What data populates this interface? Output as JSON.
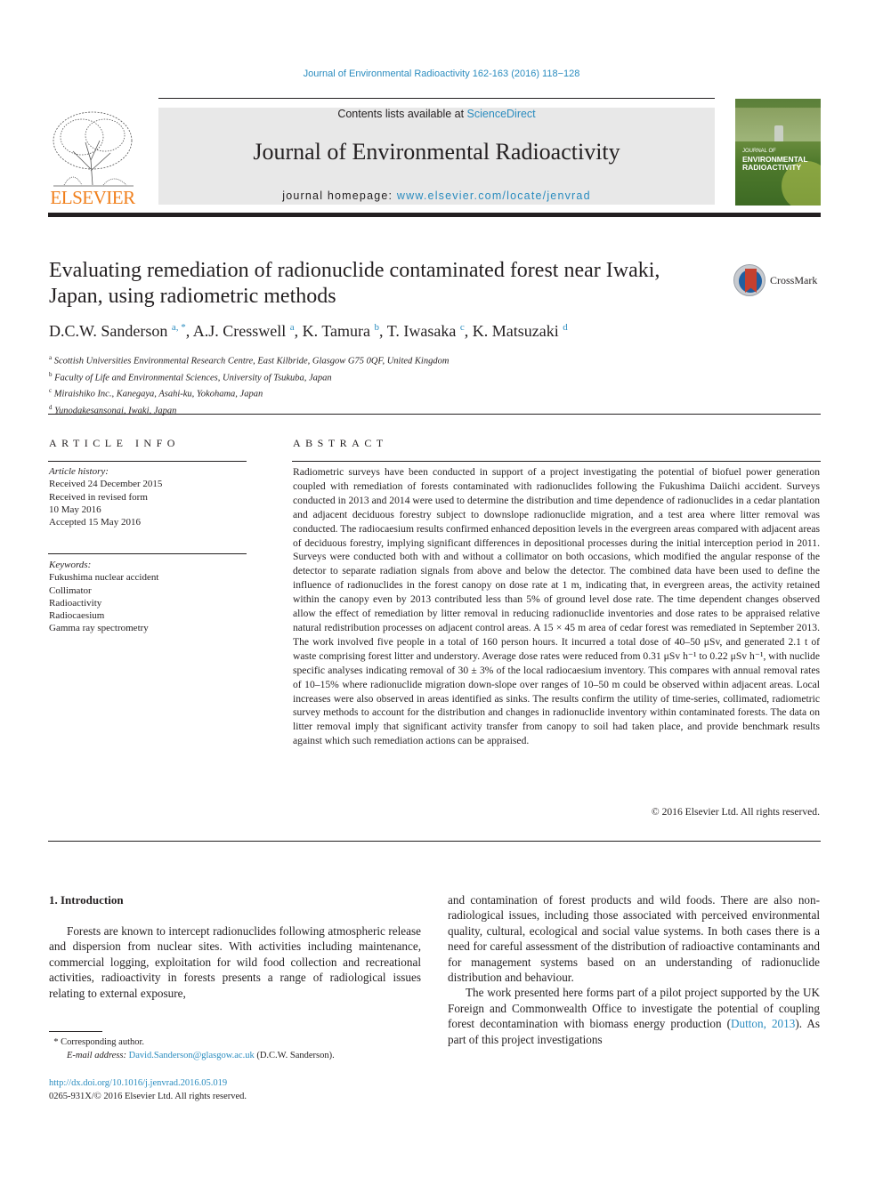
{
  "running_head": "Journal of Environmental Radioactivity 162-163 (2016) 118−128",
  "masthead": {
    "publisher_wordmark": "ELSEVIER",
    "contents_prefix": "Contents lists available at ",
    "contents_link": "ScienceDirect",
    "journal_name": "Journal of Environmental Radioactivity",
    "homepage_prefix": "journal homepage: ",
    "homepage_link": "www.elsevier.com/locate/jenvrad",
    "cover_title_small": "JOURNAL OF",
    "cover_title_line1": "ENVIRONMENTAL",
    "cover_title_line2": "RADIOACTIVITY"
  },
  "crossmark_label": "CrossMark",
  "title": "Evaluating remediation of radionuclide contaminated forest near Iwaki, Japan, using radiometric methods",
  "authors": [
    {
      "name": "D.C.W. Sanderson",
      "sup": "a, *"
    },
    {
      "name": "A.J. Cresswell",
      "sup": "a"
    },
    {
      "name": "K. Tamura",
      "sup": "b"
    },
    {
      "name": "T. Iwasaka",
      "sup": "c"
    },
    {
      "name": "K. Matsuzaki",
      "sup": "d"
    }
  ],
  "affiliations": [
    {
      "sup": "a",
      "text": "Scottish Universities Environmental Research Centre, East Kilbride, Glasgow G75 0QF, United Kingdom"
    },
    {
      "sup": "b",
      "text": "Faculty of Life and Environmental Sciences, University of Tsukuba, Japan"
    },
    {
      "sup": "c",
      "text": "Miraishiko Inc., Kanegaya, Asahi-ku, Yokohama, Japan"
    },
    {
      "sup": "d",
      "text": "Yunodakesansonai, Iwaki, Japan"
    }
  ],
  "article_info": {
    "heading": "ARTICLE INFO",
    "history_label": "Article history:",
    "history": [
      "Received 24 December 2015",
      "Received in revised form",
      "10 May 2016",
      "Accepted 15 May 2016"
    ],
    "keywords_label": "Keywords:",
    "keywords": [
      "Fukushima nuclear accident",
      "Collimator",
      "Radioactivity",
      "Radiocaesium",
      "Gamma ray spectrometry"
    ]
  },
  "abstract": {
    "heading": "ABSTRACT",
    "text": "Radiometric surveys have been conducted in support of a project investigating the potential of biofuel power generation coupled with remediation of forests contaminated with radionuclides following the Fukushima Daiichi accident. Surveys conducted in 2013 and 2014 were used to determine the distri­bution and time dependence of radionuclides in a cedar plantation and adjacent deciduous forestry subject to downslope radionuclide migration, and a test area where litter removal was conducted. The radiocaesium results confirmed enhanced deposition levels in the evergreen areas compared with adjacent areas of deciduous forestry, implying significant differences in depositional processes during the initial interception period in 2011. Surveys were conducted both with and without a collimator on both occasions, which modified the angular response of the detector to separate radiation signals from above and below the detector. The combined data have been used to define the influence of radionuclides in the forest canopy on dose rate at 1 m, indicating that, in evergreen areas, the activity retained within the canopy even by 2013 contributed less than 5% of ground level dose rate. The time dependent changes observed allow the effect of remediation by litter removal in reducing radionuclide inventories and dose rates to be appraised relative natural redistribution processes on adjacent control areas. A 15 × 45 m area of cedar forest was remediated in September 2013. The work involved five people in a total of 160 person hours. It incurred a total dose of 40–50 μSv, and generated 2.1 t of waste comprising forest litter and understory. Average dose rates were reduced from 0.31 μSv h⁻¹ to 0.22 μSv h⁻¹, with nuclide specific analyses indicating removal of 30 ± 3% of the local radiocaesium inventory. This compares with annual removal rates of 10–15% where radionuclide migration down-slope over ranges of 10–50 m could be observed within adjacent areas. Local increases were also observed in areas identified as sinks. The re­sults confirm the utility of time-series, collimated, radiometric survey methods to account for the dis­tribution and changes in radionuclide inventory within contaminated forests. The data on litter removal imply that significant activity transfer from canopy to soil had taken place, and provide benchmark results against which such remediation actions can be appraised.",
    "copyright": "© 2016 Elsevier Ltd. All rights reserved."
  },
  "introduction": {
    "heading": "1.  Introduction",
    "left_para": "Forests are known to intercept radionuclides following atmo­spheric release and dispersion from nuclear sites. With activities including maintenance, commercial logging, exploitation for wild food collection and recreational activities, radioactivity in forests presents a range of radiological issues relating to external exposure,",
    "right_para1": "and contamination of forest products and wild foods. There are also non-radiological issues, including those associated with perceived environmental quality, cultural, ecological and social value systems. In both cases there is a need for careful assessment of the distri­bution of radioactive contaminants and for management systems based on an understanding of radionuclide distribution and behaviour.",
    "right_para2_before": "The work presented here forms part of a pilot project supported by the UK Foreign and Commonwealth Office to investigate the potential of coupling forest decontamination with biomass energy production (",
    "right_para2_link": "Dutton, 2013",
    "right_para2_after": "). As part of this project investigations"
  },
  "footnotes": {
    "corresponding_mark": "*",
    "corresponding_text": "Corresponding author.",
    "email_label": "E-mail address:",
    "email": "David.Sanderson@glasgow.ac.uk",
    "email_owner": "(D.C.W. Sanderson).",
    "doi": "http://dx.doi.org/10.1016/j.jenvrad.2016.05.019",
    "issn_line": "0265-931X/© 2016 Elsevier Ltd. All rights reserved."
  }
}
